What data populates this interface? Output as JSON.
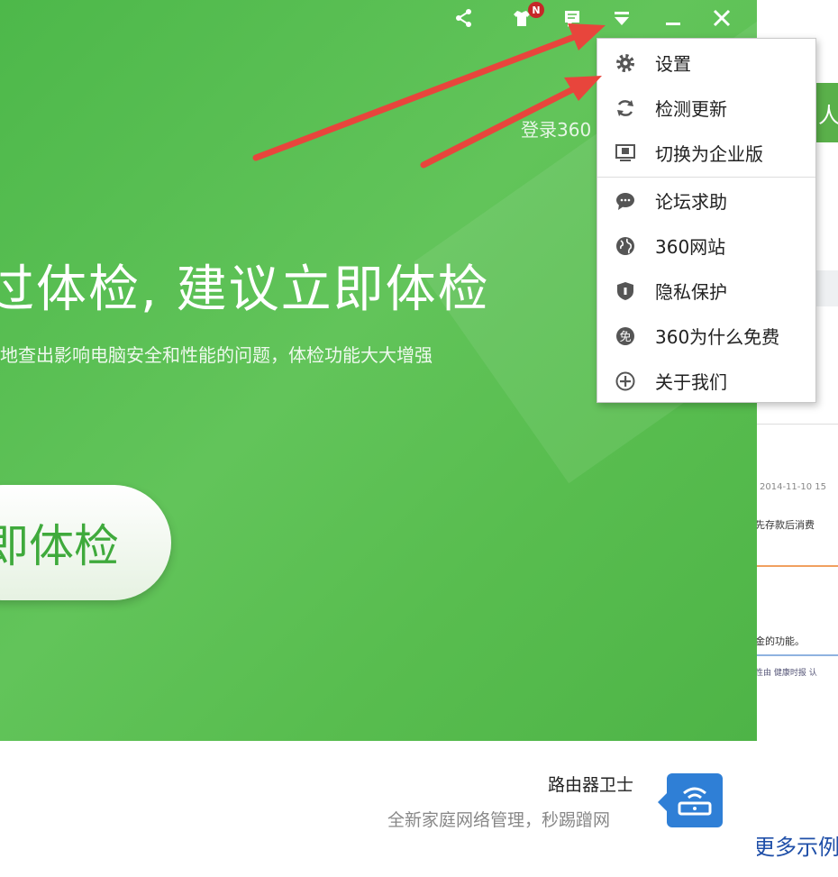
{
  "app": {
    "login_text": "登录360",
    "headline": "过体检, 建议立即体检",
    "subline": "地查出影响电脑安全和性能的问题，体检功能大大增强",
    "scan_button": "即体检",
    "router": {
      "title": "路由器卫士",
      "subtitle": "全新家庭网络管理，秒踢蹭网"
    },
    "badge": "N"
  },
  "menu": {
    "items": [
      {
        "label": "设置",
        "icon": "gear-icon"
      },
      {
        "label": "检测更新",
        "icon": "refresh-icon"
      },
      {
        "label": "切换为企业版",
        "icon": "monitor-icon"
      },
      {
        "label": "论坛求助",
        "icon": "chat-bubble-icon"
      },
      {
        "label": "360网站",
        "icon": "globe-icon"
      },
      {
        "label": "隐私保护",
        "icon": "shield-icon"
      },
      {
        "label": "360为什么免费",
        "icon": "free-icon"
      },
      {
        "label": "关于我们",
        "icon": "plus-circle-icon"
      }
    ]
  },
  "background_page": {
    "header_char": "人",
    "date": "2014-11-10 15",
    "line1": "先存款后消费",
    "line2": "金的功能。",
    "line3": "性由  健康时报 认",
    "more": "更多示例"
  },
  "colors": {
    "green": "#58bd4f",
    "accent": "#3faa3c",
    "router_blue": "#2f7fd6",
    "arrow": "#e8453c"
  }
}
